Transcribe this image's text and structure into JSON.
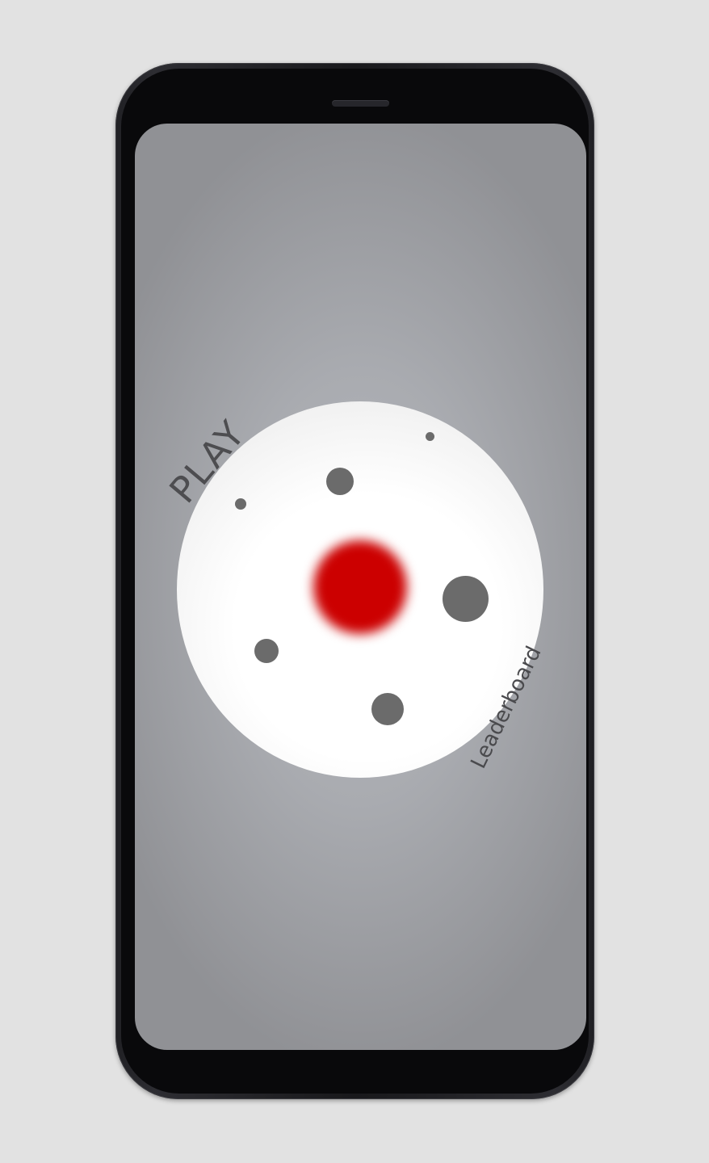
{
  "menu": {
    "play_label": "PLAY",
    "leaderboard_label": "Leaderboard"
  },
  "colors": {
    "background": "#e2e2e2",
    "screen": "#a9abb0",
    "disc": "#ffffff",
    "core": "#cc0000",
    "orbs": "#6b6b6b",
    "text": "#4d4d50"
  },
  "icons": [
    "red-core-orb",
    "grey-orb"
  ]
}
